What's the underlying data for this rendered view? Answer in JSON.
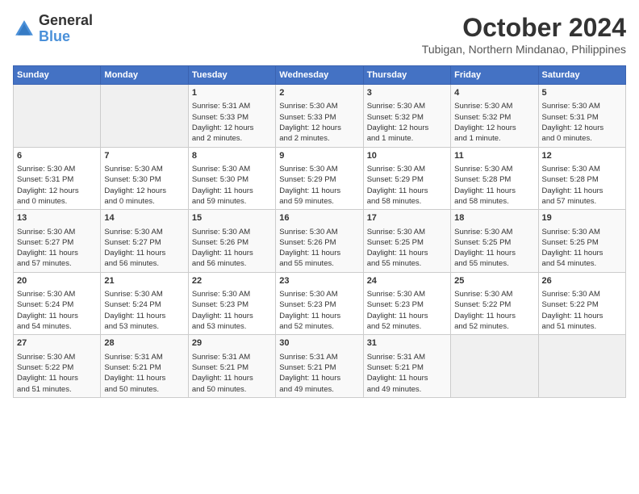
{
  "header": {
    "logo_line1": "General",
    "logo_line2": "Blue",
    "month": "October 2024",
    "location": "Tubigan, Northern Mindanao, Philippines"
  },
  "days_of_week": [
    "Sunday",
    "Monday",
    "Tuesday",
    "Wednesday",
    "Thursday",
    "Friday",
    "Saturday"
  ],
  "weeks": [
    [
      {
        "day": "",
        "content": ""
      },
      {
        "day": "",
        "content": ""
      },
      {
        "day": "1",
        "content": "Sunrise: 5:31 AM\nSunset: 5:33 PM\nDaylight: 12 hours\nand 2 minutes."
      },
      {
        "day": "2",
        "content": "Sunrise: 5:30 AM\nSunset: 5:33 PM\nDaylight: 12 hours\nand 2 minutes."
      },
      {
        "day": "3",
        "content": "Sunrise: 5:30 AM\nSunset: 5:32 PM\nDaylight: 12 hours\nand 1 minute."
      },
      {
        "day": "4",
        "content": "Sunrise: 5:30 AM\nSunset: 5:32 PM\nDaylight: 12 hours\nand 1 minute."
      },
      {
        "day": "5",
        "content": "Sunrise: 5:30 AM\nSunset: 5:31 PM\nDaylight: 12 hours\nand 0 minutes."
      }
    ],
    [
      {
        "day": "6",
        "content": "Sunrise: 5:30 AM\nSunset: 5:31 PM\nDaylight: 12 hours\nand 0 minutes."
      },
      {
        "day": "7",
        "content": "Sunrise: 5:30 AM\nSunset: 5:30 PM\nDaylight: 12 hours\nand 0 minutes."
      },
      {
        "day": "8",
        "content": "Sunrise: 5:30 AM\nSunset: 5:30 PM\nDaylight: 11 hours\nand 59 minutes."
      },
      {
        "day": "9",
        "content": "Sunrise: 5:30 AM\nSunset: 5:29 PM\nDaylight: 11 hours\nand 59 minutes."
      },
      {
        "day": "10",
        "content": "Sunrise: 5:30 AM\nSunset: 5:29 PM\nDaylight: 11 hours\nand 58 minutes."
      },
      {
        "day": "11",
        "content": "Sunrise: 5:30 AM\nSunset: 5:28 PM\nDaylight: 11 hours\nand 58 minutes."
      },
      {
        "day": "12",
        "content": "Sunrise: 5:30 AM\nSunset: 5:28 PM\nDaylight: 11 hours\nand 57 minutes."
      }
    ],
    [
      {
        "day": "13",
        "content": "Sunrise: 5:30 AM\nSunset: 5:27 PM\nDaylight: 11 hours\nand 57 minutes."
      },
      {
        "day": "14",
        "content": "Sunrise: 5:30 AM\nSunset: 5:27 PM\nDaylight: 11 hours\nand 56 minutes."
      },
      {
        "day": "15",
        "content": "Sunrise: 5:30 AM\nSunset: 5:26 PM\nDaylight: 11 hours\nand 56 minutes."
      },
      {
        "day": "16",
        "content": "Sunrise: 5:30 AM\nSunset: 5:26 PM\nDaylight: 11 hours\nand 55 minutes."
      },
      {
        "day": "17",
        "content": "Sunrise: 5:30 AM\nSunset: 5:25 PM\nDaylight: 11 hours\nand 55 minutes."
      },
      {
        "day": "18",
        "content": "Sunrise: 5:30 AM\nSunset: 5:25 PM\nDaylight: 11 hours\nand 55 minutes."
      },
      {
        "day": "19",
        "content": "Sunrise: 5:30 AM\nSunset: 5:25 PM\nDaylight: 11 hours\nand 54 minutes."
      }
    ],
    [
      {
        "day": "20",
        "content": "Sunrise: 5:30 AM\nSunset: 5:24 PM\nDaylight: 11 hours\nand 54 minutes."
      },
      {
        "day": "21",
        "content": "Sunrise: 5:30 AM\nSunset: 5:24 PM\nDaylight: 11 hours\nand 53 minutes."
      },
      {
        "day": "22",
        "content": "Sunrise: 5:30 AM\nSunset: 5:23 PM\nDaylight: 11 hours\nand 53 minutes."
      },
      {
        "day": "23",
        "content": "Sunrise: 5:30 AM\nSunset: 5:23 PM\nDaylight: 11 hours\nand 52 minutes."
      },
      {
        "day": "24",
        "content": "Sunrise: 5:30 AM\nSunset: 5:23 PM\nDaylight: 11 hours\nand 52 minutes."
      },
      {
        "day": "25",
        "content": "Sunrise: 5:30 AM\nSunset: 5:22 PM\nDaylight: 11 hours\nand 52 minutes."
      },
      {
        "day": "26",
        "content": "Sunrise: 5:30 AM\nSunset: 5:22 PM\nDaylight: 11 hours\nand 51 minutes."
      }
    ],
    [
      {
        "day": "27",
        "content": "Sunrise: 5:30 AM\nSunset: 5:22 PM\nDaylight: 11 hours\nand 51 minutes."
      },
      {
        "day": "28",
        "content": "Sunrise: 5:31 AM\nSunset: 5:21 PM\nDaylight: 11 hours\nand 50 minutes."
      },
      {
        "day": "29",
        "content": "Sunrise: 5:31 AM\nSunset: 5:21 PM\nDaylight: 11 hours\nand 50 minutes."
      },
      {
        "day": "30",
        "content": "Sunrise: 5:31 AM\nSunset: 5:21 PM\nDaylight: 11 hours\nand 49 minutes."
      },
      {
        "day": "31",
        "content": "Sunrise: 5:31 AM\nSunset: 5:21 PM\nDaylight: 11 hours\nand 49 minutes."
      },
      {
        "day": "",
        "content": ""
      },
      {
        "day": "",
        "content": ""
      }
    ]
  ]
}
